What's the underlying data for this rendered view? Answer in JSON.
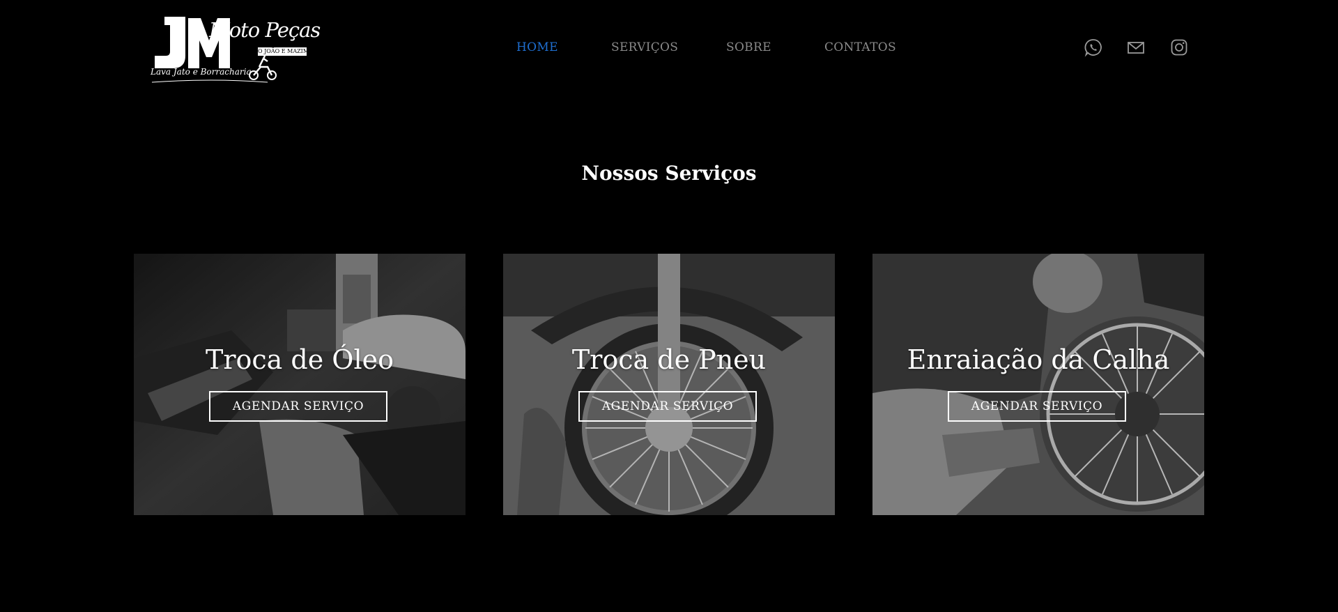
{
  "logo": {
    "initials": "JM",
    "script_title": "Moto Peças",
    "tagline": "O JOÃO E MAZIM",
    "subtitle": "Lava Jato e Borracharia"
  },
  "nav": {
    "items": [
      {
        "label": "HOME",
        "active": true
      },
      {
        "label": "SERVIÇOS",
        "active": false
      },
      {
        "label": "SOBRE",
        "active": false
      },
      {
        "label": "CONTATOS",
        "active": false
      }
    ],
    "active_color": "#1f6fd1",
    "inactive_color": "#8a8a8a"
  },
  "social": {
    "icons": [
      "whatsapp-icon",
      "mail-icon",
      "instagram-icon"
    ]
  },
  "section": {
    "title": "Nossos Serviços"
  },
  "services": [
    {
      "title": "Troca de Óleo",
      "button": "AGENDAR SERVIÇO",
      "image": "oil-change-photo"
    },
    {
      "title": "Troca de Pneu",
      "button": "AGENDAR SERVIÇO",
      "image": "tire-change-photo"
    },
    {
      "title": "Enraiação da Calha",
      "button": "AGENDAR SERVIÇO",
      "image": "wheel-spoking-photo"
    }
  ],
  "colors": {
    "background": "#000000",
    "text": "#ffffff"
  }
}
